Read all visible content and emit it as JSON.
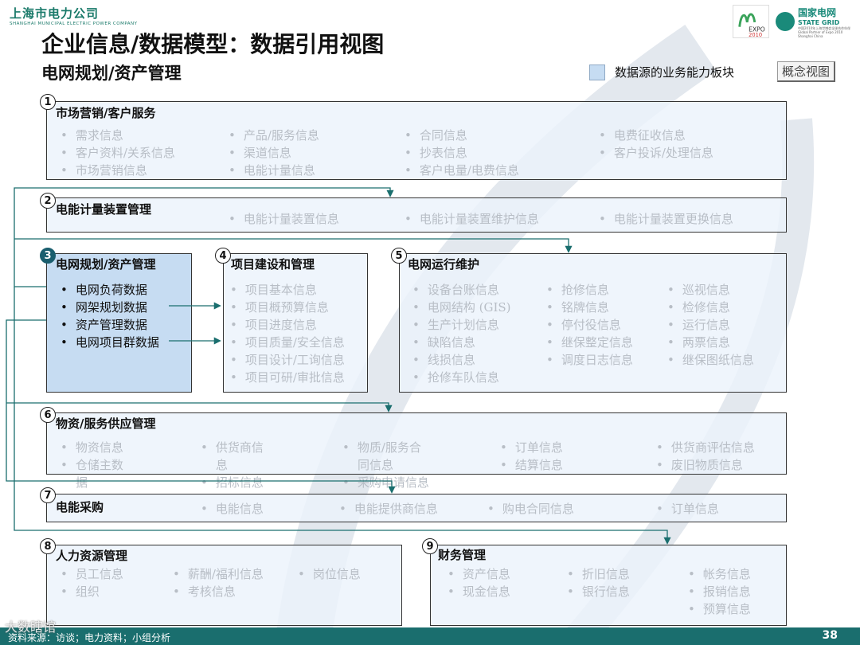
{
  "header": {
    "company_cn": "上海市电力公司",
    "company_en": "SHANGHAI MUNICIPAL ELECTRIC POWER COMPANY",
    "grid_cn": "国家电网",
    "grid_en": "STATE GRID",
    "grid_sub": "中国2010年上海世博会全球合作伙伴 Global Partner of Expo 2010 Shanghai China",
    "title": "企业信息/数据模型：数据引用视图",
    "subtitle": "电网规划/资产管理"
  },
  "legend": {
    "label": "数据源的业务能力板块",
    "color": "#c6dcf2"
  },
  "concept_button": "概念视图",
  "boxes": {
    "b1": {
      "num": "1",
      "title": "市场营销/客户服务",
      "items": [
        "需求信息",
        "客户资料/关系信息",
        "市场营销信息",
        "产品/服务信息",
        "渠道信息",
        "电能计量信息",
        "合同信息",
        "抄表信息",
        "客户电量/电费信息",
        "电费征收信息",
        "客户投诉/处理信息"
      ]
    },
    "b2": {
      "num": "2",
      "title": "电能计量装置管理",
      "items": [
        "电能计量装置信息",
        "电能计量装置维护信息",
        "电能计量装置更换信息"
      ]
    },
    "b3": {
      "num": "3",
      "title": "电网规划/资产管理",
      "items": [
        "电网负荷数据",
        "网架规划数据",
        "资产管理数据",
        "电网项目群数据"
      ]
    },
    "b4": {
      "num": "4",
      "title": "项目建设和管理",
      "items": [
        "项目基本信息",
        "项目概预算信息",
        "项目进度信息",
        "项目质量/安全信息",
        "项目设计/工询信息",
        "项目可研/审批信息"
      ]
    },
    "b5": {
      "num": "5",
      "title": "电网运行维护",
      "items": [
        "设备台账信息",
        "电网结构 (GIS)",
        "生产计划信息",
        "缺陷信息",
        "线损信息",
        "抢修车队信息",
        "抢修信息",
        "铭牌信息",
        "停付役信息",
        "继保整定信息",
        "调度日志信息",
        "巡视信息",
        "检修信息",
        "运行信息",
        "两票信息",
        "继保图纸信息"
      ]
    },
    "b6": {
      "num": "6",
      "title": "物资/服务供应管理",
      "items": [
        "物资信息",
        "仓储主数",
        "据",
        "供货商信",
        "息",
        "招标信息",
        "物质/服务合",
        "同信息",
        "采购申请信息",
        "订单信息",
        "结算信息",
        "供货商评估信息",
        "废旧物质信息"
      ]
    },
    "b7": {
      "num": "7",
      "title": "电能采购",
      "items": [
        "电能信息",
        "电能提供商信息",
        "购电合同信息",
        "订单信息"
      ]
    },
    "b8": {
      "num": "8",
      "title": "人力资源管理",
      "items": [
        "员工信息",
        "组织",
        "薪酬/福利信息",
        "考核信息",
        "岗位信息"
      ]
    },
    "b9": {
      "num": "9",
      "title": "财务管理",
      "items": [
        "资产信息",
        "现金信息",
        "折旧信息",
        "银行信息",
        "帐务信息",
        "报销信息",
        "预算信息"
      ]
    }
  },
  "footer": {
    "source": "资料来源：访谈；电力资料；小组分析",
    "page": "38"
  },
  "watermark": "大数瞎馆",
  "colors": {
    "footer": "#1a6e6e",
    "connector": "#1a6e6e",
    "highlight": "#c6dcf2"
  }
}
